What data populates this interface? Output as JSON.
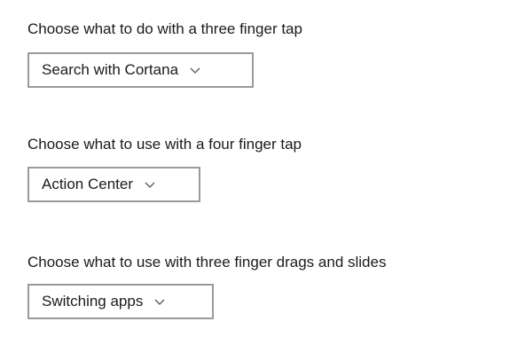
{
  "settings": [
    {
      "label": "Choose what to do with a three finger tap",
      "selected": "Search with Cortana",
      "icon": "chevron-down-icon"
    },
    {
      "label": "Choose what to use with a four finger tap",
      "selected": "Action Center",
      "icon": "chevron-down-icon"
    },
    {
      "label": "Choose what to use with three finger drags and slides",
      "selected": "Switching apps",
      "icon": "chevron-down-icon"
    }
  ]
}
